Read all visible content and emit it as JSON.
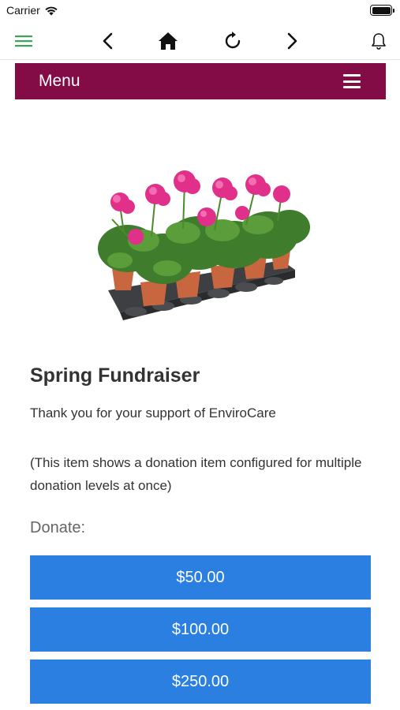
{
  "status_bar": {
    "carrier": "Carrier"
  },
  "toolbar": {
    "icons": [
      "hamburger-menu-icon",
      "back-icon",
      "home-icon",
      "reload-icon",
      "forward-icon",
      "bell-icon"
    ],
    "accent_color": "#3aa655"
  },
  "menu": {
    "label": "Menu",
    "background": "#830b46"
  },
  "product": {
    "title": "Spring Fundraiser",
    "thanks": "Thank you for your support of EnviroCare",
    "note": "(This item shows a donation item configured for multiple donation levels at once)",
    "donate_label": "Donate:"
  },
  "donation_buttons": [
    {
      "label": "$50.00"
    },
    {
      "label": "$100.00"
    },
    {
      "label": "$250.00"
    }
  ],
  "colors": {
    "button_blue": "#2b7fe0"
  }
}
